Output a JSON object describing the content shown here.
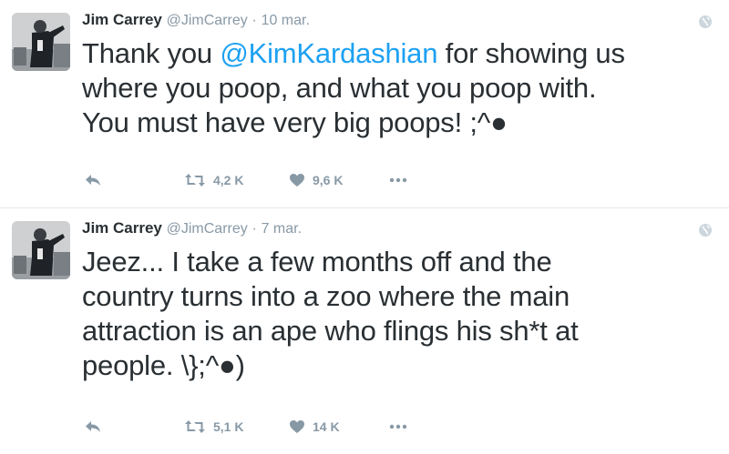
{
  "tweets": [
    {
      "author_name": "Jim Carrey",
      "author_handle": "@JimCarrey",
      "separator": "·",
      "time": "10 mar.",
      "lines": [
        [
          {
            "text": "Thank you ",
            "type": "text"
          },
          {
            "text": "@KimKardashian",
            "type": "mention"
          },
          {
            "text": " for showing us",
            "type": "text"
          }
        ],
        [
          {
            "text": "where you poop, and what you poop with.",
            "type": "text"
          }
        ],
        [
          {
            "text": "You must have very big poops! ;^●",
            "type": "text"
          }
        ]
      ],
      "retweets": "4,2 K",
      "likes": "9,6 K",
      "icons": {
        "reply": "reply-icon",
        "retweet": "retweet-icon",
        "like": "heart-icon",
        "more": "more-icon",
        "globe": "globe-icon"
      }
    },
    {
      "author_name": "Jim Carrey",
      "author_handle": "@JimCarrey",
      "separator": "·",
      "time": "7 mar.",
      "lines": [
        [
          {
            "text": "Jeez... I take a few months off and the",
            "type": "text"
          }
        ],
        [
          {
            "text": "country turns into a zoo where the main",
            "type": "text"
          }
        ],
        [
          {
            "text": "attraction is an ape who flings his sh*t at",
            "type": "text"
          }
        ],
        [
          {
            "text": "people. \\};^●)",
            "type": "text"
          }
        ]
      ],
      "retweets": "5,1 K",
      "likes": "14 K",
      "icons": {
        "reply": "reply-icon",
        "retweet": "retweet-icon",
        "like": "heart-icon",
        "more": "more-icon",
        "globe": "globe-icon"
      }
    }
  ],
  "colors": {
    "text": "#292f33",
    "muted": "#8899a6",
    "link": "#1da1f2",
    "divider": "#e1e8ed"
  }
}
